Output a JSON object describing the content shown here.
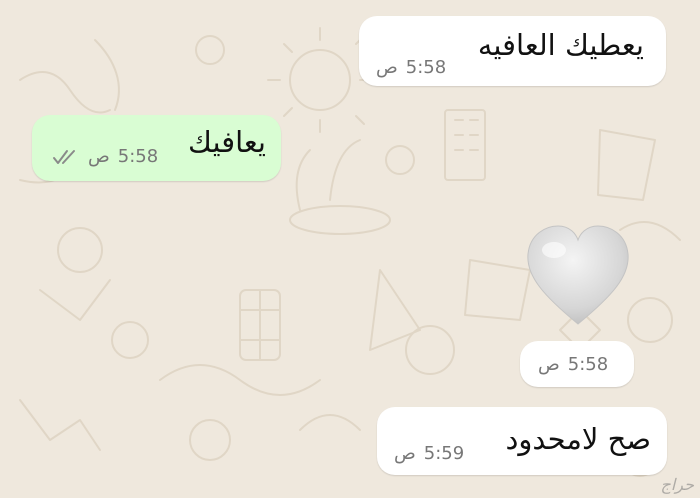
{
  "messages": [
    {
      "id": 1,
      "direction": "incoming",
      "text": "يعطيك العافيه",
      "time": "5:58",
      "ampm": "ص"
    },
    {
      "id": 2,
      "direction": "outgoing",
      "text": "يعافيك",
      "time": "5:58",
      "ampm": "ص",
      "status": "read",
      "status_icon": "double-check-icon"
    },
    {
      "id": 3,
      "direction": "incoming",
      "type": "emoji",
      "emoji": "🤍",
      "emoji_name": "white-heart",
      "time": "5:58",
      "ampm": "ص"
    },
    {
      "id": 4,
      "direction": "incoming",
      "text": "صح لامحدود",
      "time": "5:59",
      "ampm": "ص"
    }
  ],
  "watermark": "حراج",
  "colors": {
    "background": "#efe8dd",
    "incoming_bubble": "#ffffff",
    "outgoing_bubble": "#d9fdd3",
    "read_ticks": "#8a8a8a",
    "doodle": "#e2d8c8"
  }
}
